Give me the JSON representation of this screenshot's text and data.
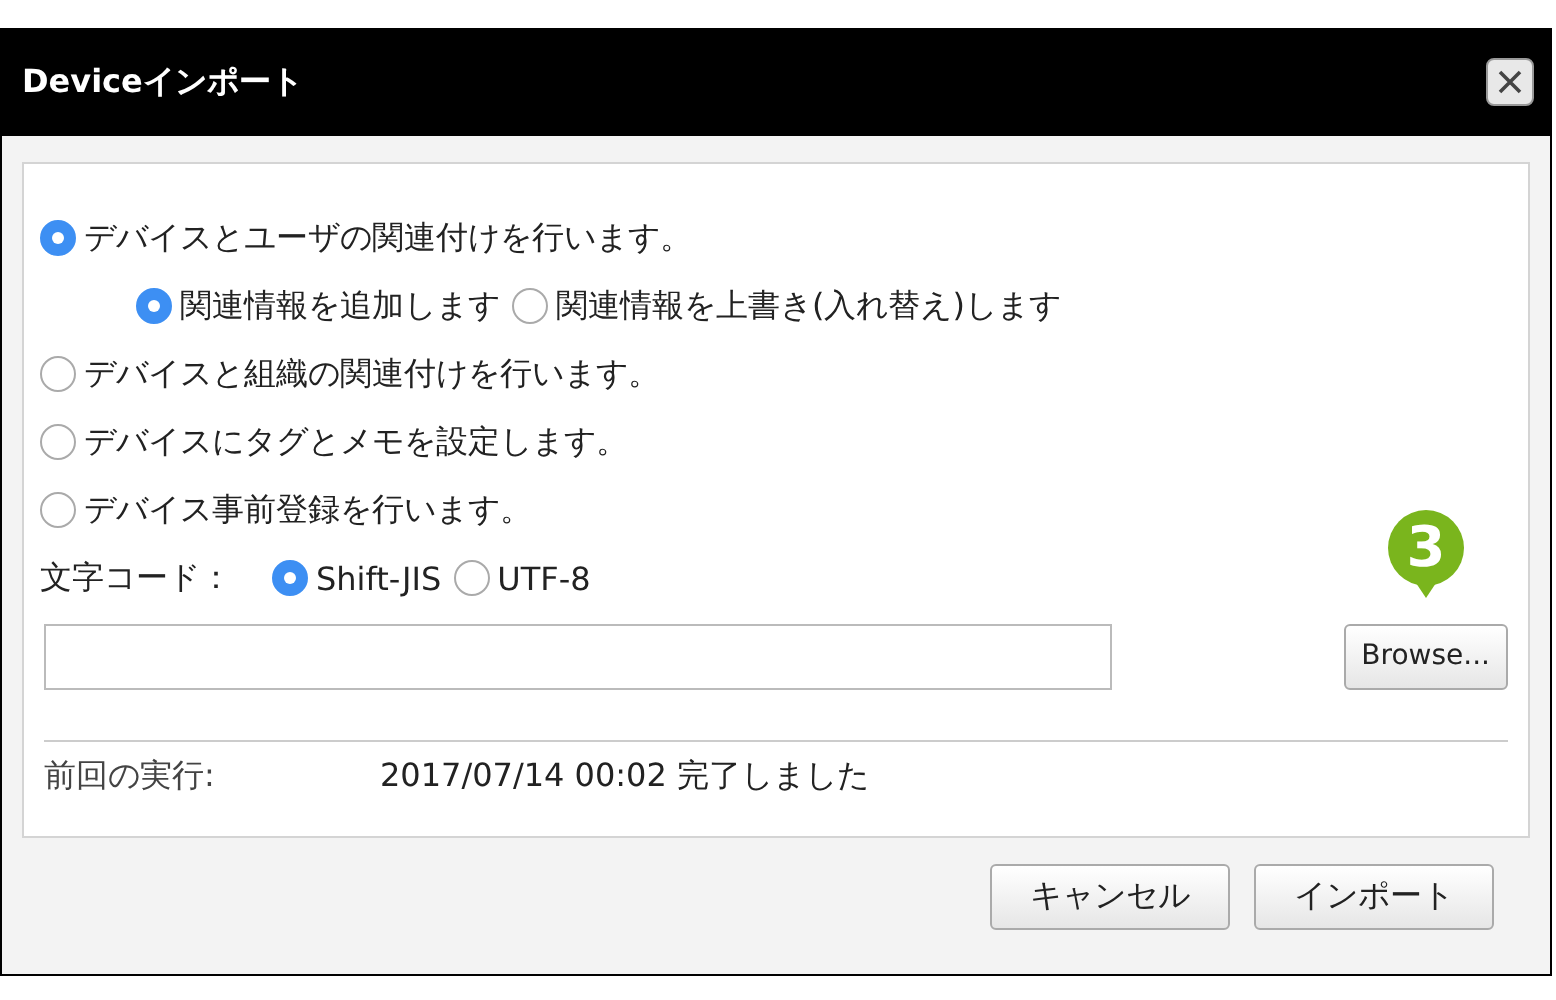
{
  "window": {
    "title": "Deviceインポート"
  },
  "options": [
    {
      "label": "デバイスとユーザの関連付けを行います。",
      "selected": true,
      "sub_options": [
        {
          "label": "関連情報を追加します",
          "selected": true
        },
        {
          "label": "関連情報を上書き(入れ替え)します",
          "selected": false
        }
      ]
    },
    {
      "label": "デバイスと組織の関連付けを行います。",
      "selected": false
    },
    {
      "label": "デバイスにタグとメモを設定します。",
      "selected": false
    },
    {
      "label": "デバイス事前登録を行います。",
      "selected": false
    }
  ],
  "encoding": {
    "label": "文字コード：",
    "options": [
      {
        "label": "Shift-JIS",
        "selected": true
      },
      {
        "label": "UTF-8",
        "selected": false
      }
    ]
  },
  "browse_button": "Browse...",
  "step_badge": "3",
  "last_run": {
    "label": "前回の実行:",
    "value": "2017/07/14 00:02 完了しました"
  },
  "buttons": [
    "キャンセル",
    "インポート"
  ]
}
